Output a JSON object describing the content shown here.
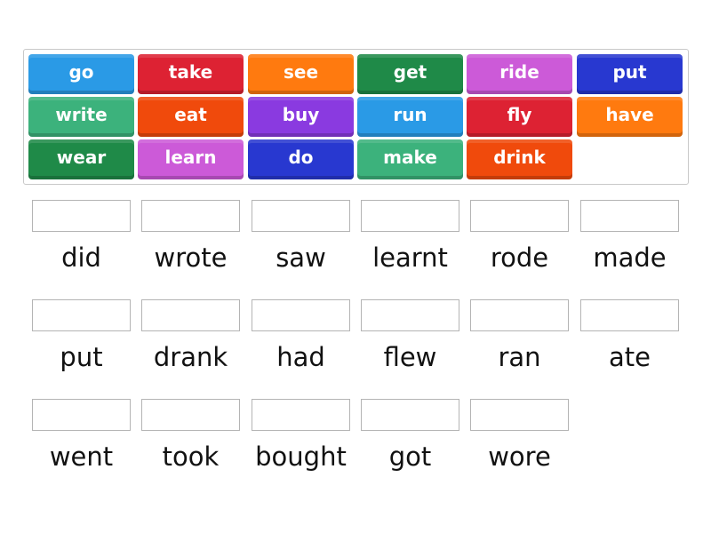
{
  "tiles": [
    {
      "label": "go",
      "color": "#2a9ae6"
    },
    {
      "label": "take",
      "color": "#dd2233"
    },
    {
      "label": "see",
      "color": "#ff7a0f"
    },
    {
      "label": "get",
      "color": "#1f8a48"
    },
    {
      "label": "ride",
      "color": "#cc5ad8"
    },
    {
      "label": "put",
      "color": "#2838d0"
    },
    {
      "label": "write",
      "color": "#3cb27c"
    },
    {
      "label": "eat",
      "color": "#f04a0c"
    },
    {
      "label": "buy",
      "color": "#8a3ae0"
    },
    {
      "label": "run",
      "color": "#2a9ae6"
    },
    {
      "label": "fly",
      "color": "#dd2233"
    },
    {
      "label": "have",
      "color": "#ff7a0f"
    },
    {
      "label": "wear",
      "color": "#1f8a48"
    },
    {
      "label": "learn",
      "color": "#cc5ad8"
    },
    {
      "label": "do",
      "color": "#2838d0"
    },
    {
      "label": "make",
      "color": "#3cb27c"
    },
    {
      "label": "drink",
      "color": "#f04a0c"
    }
  ],
  "targets": [
    {
      "label": "did"
    },
    {
      "label": "wrote"
    },
    {
      "label": "saw"
    },
    {
      "label": "learnt"
    },
    {
      "label": "rode"
    },
    {
      "label": "made"
    },
    {
      "label": "put"
    },
    {
      "label": "drank"
    },
    {
      "label": "had"
    },
    {
      "label": "flew"
    },
    {
      "label": "ran"
    },
    {
      "label": "ate"
    },
    {
      "label": "went"
    },
    {
      "label": "took"
    },
    {
      "label": "bought"
    },
    {
      "label": "got"
    },
    {
      "label": "wore"
    }
  ]
}
